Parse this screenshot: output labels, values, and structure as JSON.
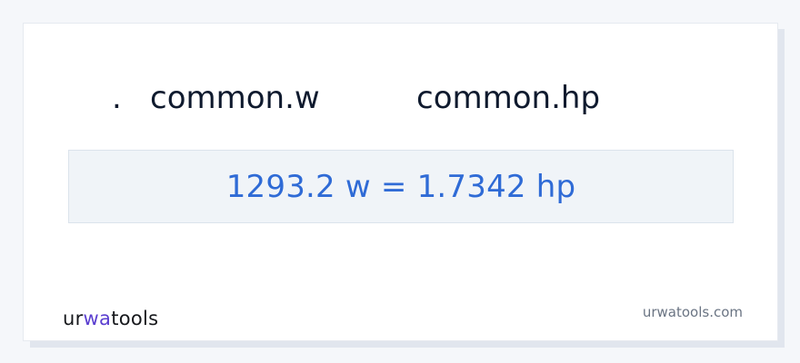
{
  "header": {
    "dot": ".",
    "from_unit": "common.w",
    "to_unit": "common.hp"
  },
  "result": {
    "text": "1293.2 w = 1.7342 hp"
  },
  "footer": {
    "logo_part1": "ur",
    "logo_part2": "wa",
    "logo_part3": "tools",
    "site": "urwatools.com"
  },
  "colors": {
    "accent": "#2f6bd6",
    "logo_accent": "#5b3fd0"
  }
}
